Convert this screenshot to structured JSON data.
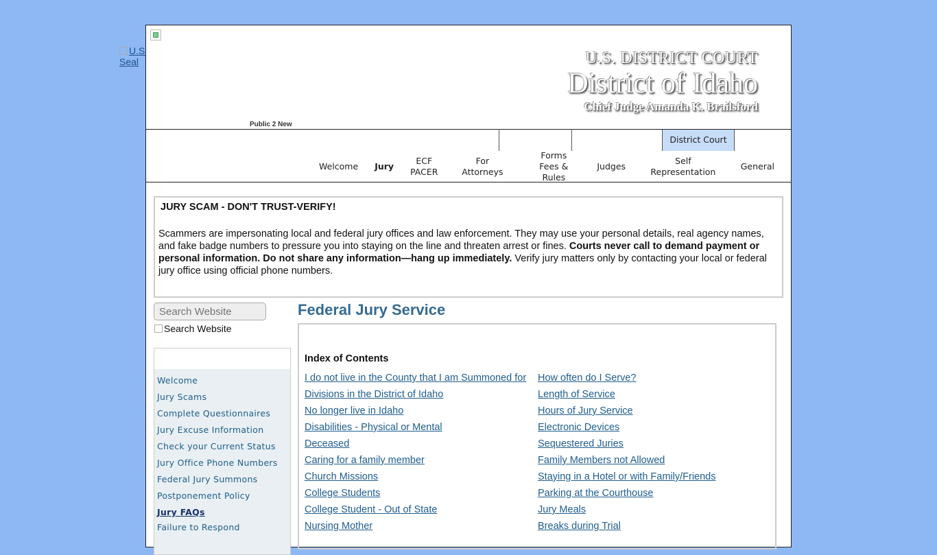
{
  "header": {
    "seal_link_text": "U.S. Courts District of Idaho Seal",
    "public_label": "Public 2 New",
    "court_line1": "U.S. DISTRICT COURT",
    "court_line2": "District of Idaho",
    "court_line3": "Chief Judge Amanda K. Brailsford"
  },
  "top_tab": "District Court",
  "nav": {
    "items": [
      {
        "line1": "Welcome",
        "line2": ""
      },
      {
        "line1": "Jury",
        "line2": "",
        "active": true
      },
      {
        "line1": "ECF",
        "line2": "PACER"
      },
      {
        "line1": "For Attorneys",
        "line2": ""
      },
      {
        "line1": "Forms",
        "line2": "Fees & Rules"
      },
      {
        "line1": "Judges",
        "line2": ""
      },
      {
        "line1": "Self Representation",
        "line2": ""
      },
      {
        "line1": "General",
        "line2": ""
      }
    ]
  },
  "alert": {
    "title": "JURY SCAM - DON'T TRUST-VERIFY!",
    "body_part1": "Scammers are impersonating local and federal jury offices and law enforcement. They may use your personal details, real agency names, and fake badge numbers to pressure you into staying on the line and threaten arrest or fines. ",
    "body_bold": "Courts never call to demand payment or personal information. Do not share any information—hang up immediately.",
    "body_part2": " Verify jury matters only by contacting your local or federal jury office using official phone numbers."
  },
  "search": {
    "placeholder": "Search Website",
    "button_alt": "Search Website"
  },
  "sidebar": {
    "items": [
      {
        "label": "Welcome"
      },
      {
        "label": "Jury Scams"
      },
      {
        "label": "Complete Questionnaires"
      },
      {
        "label": "Jury Excuse Information"
      },
      {
        "label": "Check your Current Status"
      },
      {
        "label": "Jury Office Phone Numbers"
      },
      {
        "label": "Federal Jury Summons"
      },
      {
        "label": "Postponement Policy"
      },
      {
        "label": "Jury FAQs",
        "current": true
      },
      {
        "label": "Failure to Respond"
      }
    ]
  },
  "content": {
    "title": "Federal Jury Service",
    "index_title": "Index of Contents",
    "col1": [
      "I do not live in the County that I am Summoned for",
      "Divisions in the District of Idaho",
      "No longer live in Idaho",
      "Disabilities - Physical or Mental",
      "Deceased",
      "Caring for a family member",
      "Church Missions",
      "College Students",
      "College Student - Out of State",
      "Nursing Mother"
    ],
    "col2": [
      "How often do I Serve?",
      "Length of Service",
      "Hours of Jury Service",
      "Electronic Devices",
      "Sequestered Juries",
      "Family Members not Allowed",
      "Staying in a Hotel or with Family/Friends",
      "Parking at the Courthouse",
      "Jury Meals",
      "Breaks during Trial"
    ]
  }
}
